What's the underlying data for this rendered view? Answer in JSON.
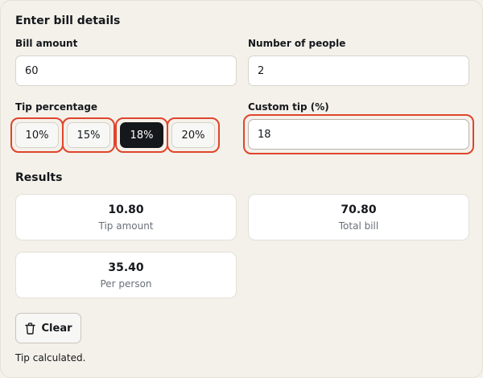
{
  "form": {
    "title": "Enter bill details",
    "bill_amount": {
      "label": "Bill amount",
      "value": "60"
    },
    "people": {
      "label": "Number of people",
      "value": "2"
    },
    "tip": {
      "label": "Tip percentage",
      "options": [
        "10%",
        "15%",
        "18%",
        "20%"
      ],
      "selected": "18%"
    },
    "custom_tip": {
      "label": "Custom tip (%)",
      "value": "18"
    }
  },
  "results": {
    "title": "Results",
    "tip_amount": {
      "value": "10.80",
      "caption": "Tip amount"
    },
    "total_bill": {
      "value": "70.80",
      "caption": "Total bill"
    },
    "per_person": {
      "value": "35.40",
      "caption": "Per person"
    }
  },
  "actions": {
    "clear_label": "Clear",
    "clear_icon": "trash-icon"
  },
  "status": "Tip calculated.",
  "colors": {
    "background": "#f4f1ea",
    "active_tip": "#14171b",
    "highlight_ring": "#e0442c",
    "caption": "#6a6f78"
  }
}
